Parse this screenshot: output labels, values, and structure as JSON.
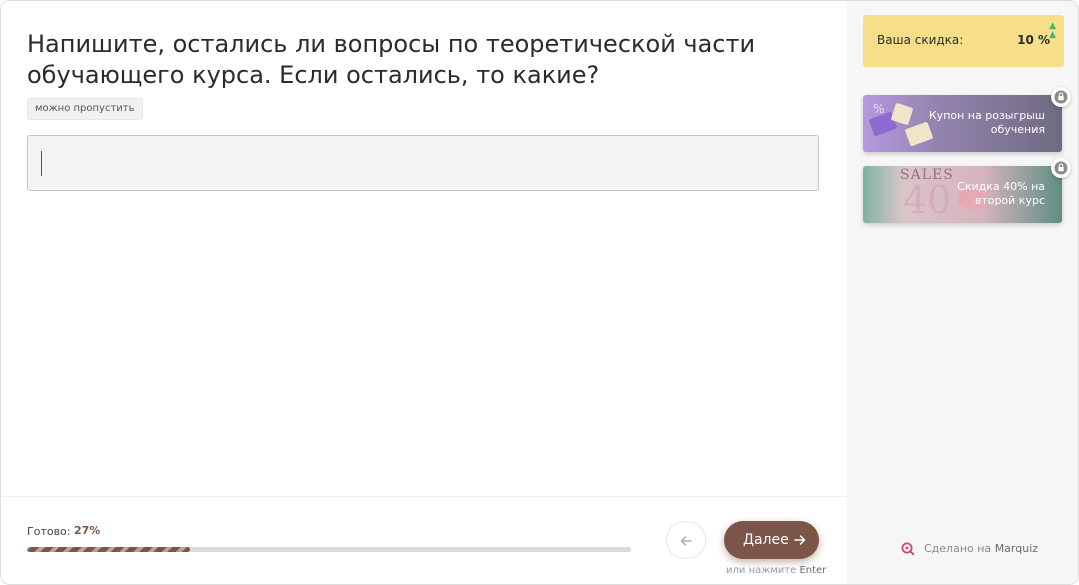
{
  "question": {
    "title": "Напишите, остались ли вопросы по теоретической части обучающего курса. Если остались, то какие?",
    "skip_label": "можно пропустить",
    "answer_value": "",
    "answer_placeholder": ""
  },
  "progress": {
    "label": "Готово:",
    "value_text": "27%",
    "fraction": 0.27
  },
  "navigation": {
    "back_icon": "arrow-left-icon",
    "next_label": "Далее",
    "next_icon": "arrow-right-icon",
    "enter_hint_prefix": "или нажмите",
    "enter_hint_key": "Enter"
  },
  "sidebar": {
    "discount_label": "Ваша скидка:",
    "discount_value": "10 %",
    "bonuses": [
      {
        "label": "Купон на розыгрыш обучения",
        "icon": "lock-icon"
      },
      {
        "label": "Скидка 40% на второй курс",
        "icon": "lock-icon"
      }
    ],
    "made_with_prefix": "Сделано на",
    "made_with_brand": "Marquiz"
  },
  "colors": {
    "accent": "#7b5648",
    "discount_bg": "#f7df8a",
    "sidebar_bg": "#f6f6f6",
    "brand_icon": "#d4417a",
    "discount_up": "#4db36a"
  }
}
